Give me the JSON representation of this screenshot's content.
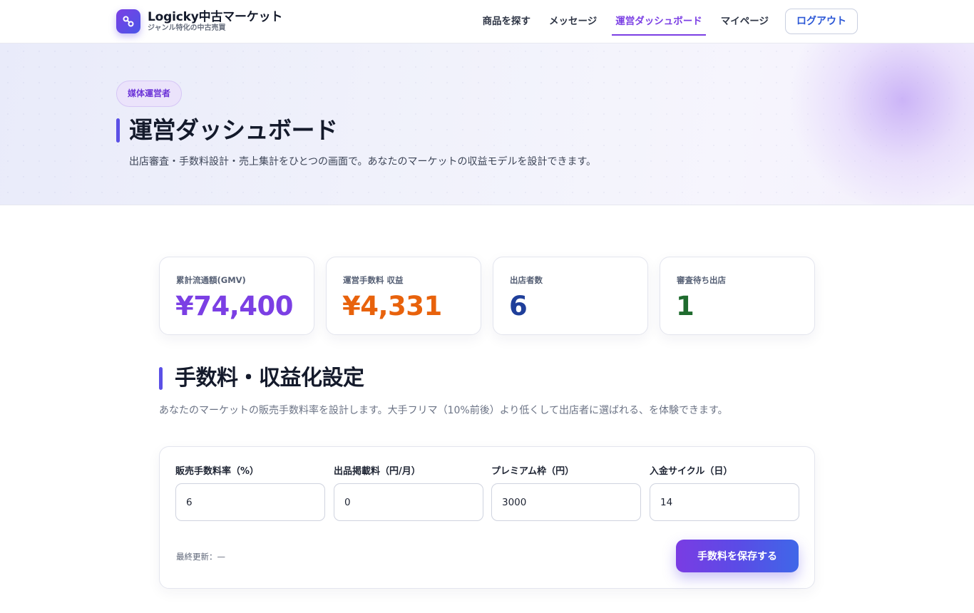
{
  "app": {
    "name": "Logicky中古マーケット",
    "tagline": "ジャンル特化の中古売買"
  },
  "nav": {
    "items": [
      {
        "label": "商品を探す"
      },
      {
        "label": "メッセージ"
      },
      {
        "label": "運営ダッシュボード",
        "active": true
      },
      {
        "label": "マイページ"
      }
    ],
    "logout_label": "ログアウト"
  },
  "hero": {
    "badge": "媒体運営者",
    "title": "運営ダッシュボード",
    "description": "出店審査・手数料設計・売上集計をひとつの画面で。あなたのマーケットの収益モデルを設計できます。"
  },
  "stats": [
    {
      "label": "累計流通額(GMV)",
      "value": "¥74,400",
      "color": "#7b3fe4"
    },
    {
      "label": "運営手数料 収益",
      "value": "¥4,331",
      "color": "#e8620c"
    },
    {
      "label": "出店者数",
      "value": "6",
      "color": "#1f3f9a"
    },
    {
      "label": "審査待ち出店",
      "value": "1",
      "color": "#1f6b2e"
    }
  ],
  "fees": {
    "title": "手数料・収益化設定",
    "description": "あなたのマーケットの販売手数料率を設計します。大手フリマ（10%前後）より低くして出店者に選ばれる、を体験できます。",
    "fields": [
      {
        "label": "販売手数料率（%）",
        "value": "6"
      },
      {
        "label": "出品掲載料（円/月）",
        "value": "0"
      },
      {
        "label": "プレミアム枠（円）",
        "value": "3000"
      },
      {
        "label": "入金サイクル（日）",
        "value": "14"
      }
    ],
    "last_updated": "最終更新：—",
    "save_label": "手数料を保存する"
  },
  "colors": {
    "accent": "#7b3fe4",
    "primary_blue": "#2b57d6"
  }
}
